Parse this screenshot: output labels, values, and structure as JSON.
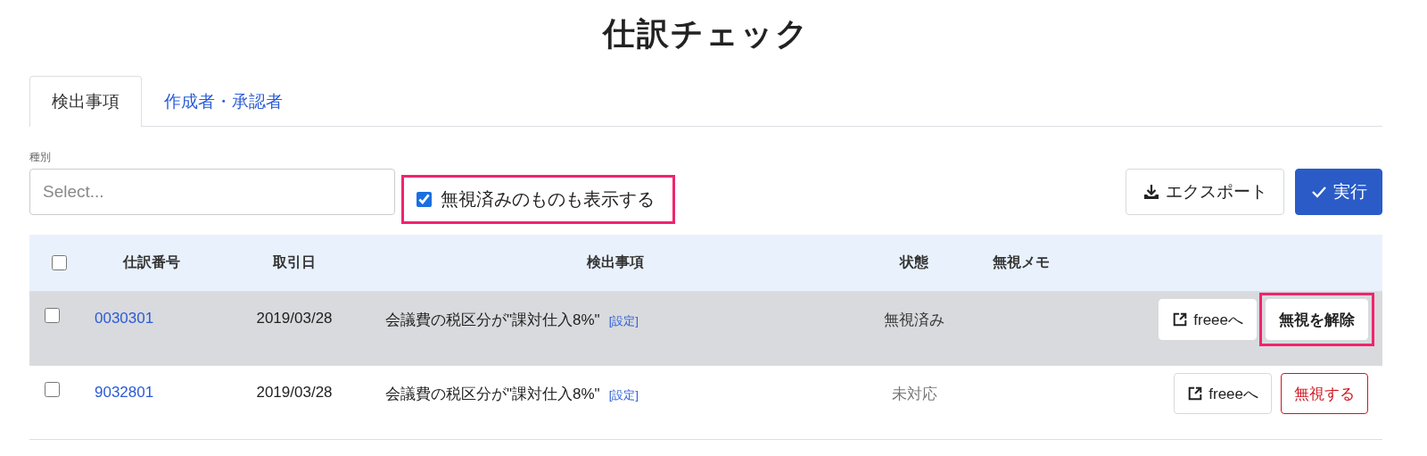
{
  "title": "仕訳チェック",
  "tabs": [
    {
      "label": "検出事項",
      "selected": true
    },
    {
      "label": "作成者・承認者",
      "selected": false
    }
  ],
  "filter": {
    "label": "種別",
    "placeholder": "Select..."
  },
  "show_ignored": {
    "label": "無視済みのものも表示する",
    "checked": true,
    "highlighted": true
  },
  "toolbar_buttons": [
    {
      "label": "エクスポート",
      "kind": "export"
    },
    {
      "label": "実行",
      "kind": "run"
    }
  ],
  "table": {
    "select_all": {
      "checked": false
    },
    "columns": [
      "仕訳番号",
      "取引日",
      "検出事項",
      "状態",
      "無視メモ"
    ],
    "rows": [
      {
        "checked": false,
        "ignored": true,
        "number": "0030301",
        "date": "2019/03/28",
        "finding": "会議費の税区分が\"課対仕入8%\"",
        "settings_link": "[設定]",
        "status": "無視済み",
        "buttons": [
          {
            "label": "freeeへ",
            "kind": "open",
            "highlighted": false
          },
          {
            "label": "無視を解除",
            "kind": "unignore",
            "highlighted": true
          }
        ]
      },
      {
        "checked": false,
        "ignored": false,
        "number": "9032801",
        "date": "2019/03/28",
        "finding": "会議費の税区分が\"課対仕入8%\"",
        "settings_link": "[設定]",
        "status": "未対応",
        "buttons": [
          {
            "label": "freeeへ",
            "kind": "open",
            "highlighted": false
          },
          {
            "label": "無視する",
            "kind": "ignore",
            "highlighted": false
          }
        ]
      }
    ]
  }
}
